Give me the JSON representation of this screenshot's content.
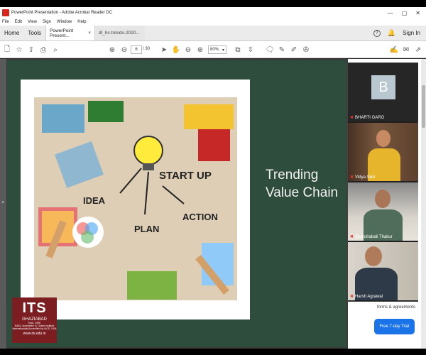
{
  "titlebar": {
    "title": "PowerPoint Presentation - Adobe Acrobat Reader DC",
    "minimize": "—",
    "maximize": "▢",
    "close": "✕"
  },
  "menu": [
    "File",
    "Edit",
    "View",
    "Sign",
    "Window",
    "Help"
  ],
  "tabs": {
    "home": "Home",
    "tools": "Tools",
    "active_doc": "PowerPoint Present...",
    "other_doc": "dl_hc-trends-2020...",
    "close": "×",
    "sign_in": "Sign In"
  },
  "toolbar": {
    "page_current": "6",
    "page_total": "/ 30",
    "zoom": "80%"
  },
  "slide": {
    "heading_line1": "Trending",
    "heading_line2": "Value Chain",
    "logo": {
      "name": "ITS",
      "city": "GHAZIABAD",
      "line1": "Estd. 1995",
      "line2": "NAAC Accredited 'A' Grade Institute",
      "line3": "Internationally Accredited by IACE, USA",
      "url": "www.its.edu.in"
    }
  },
  "image_text": {
    "start_up": "START UP",
    "idea": "IDEA",
    "plan": "PLAN",
    "action": "ACTION"
  },
  "participants": [
    {
      "name": "BHARTI GARG",
      "avatar_letter": "B"
    },
    {
      "name": "Vidya Sikri"
    },
    {
      "name": "Chandrabali Thakur"
    },
    {
      "name": "Harsh Agrawal"
    }
  ],
  "side_panel": {
    "cta_text": "forms & agreements",
    "button": "Free 7-day Trial"
  },
  "colors": {
    "slide_bg": "#2f4d3c",
    "logo_bg": "#7b1d21",
    "trial_button": "#1a73e8"
  }
}
